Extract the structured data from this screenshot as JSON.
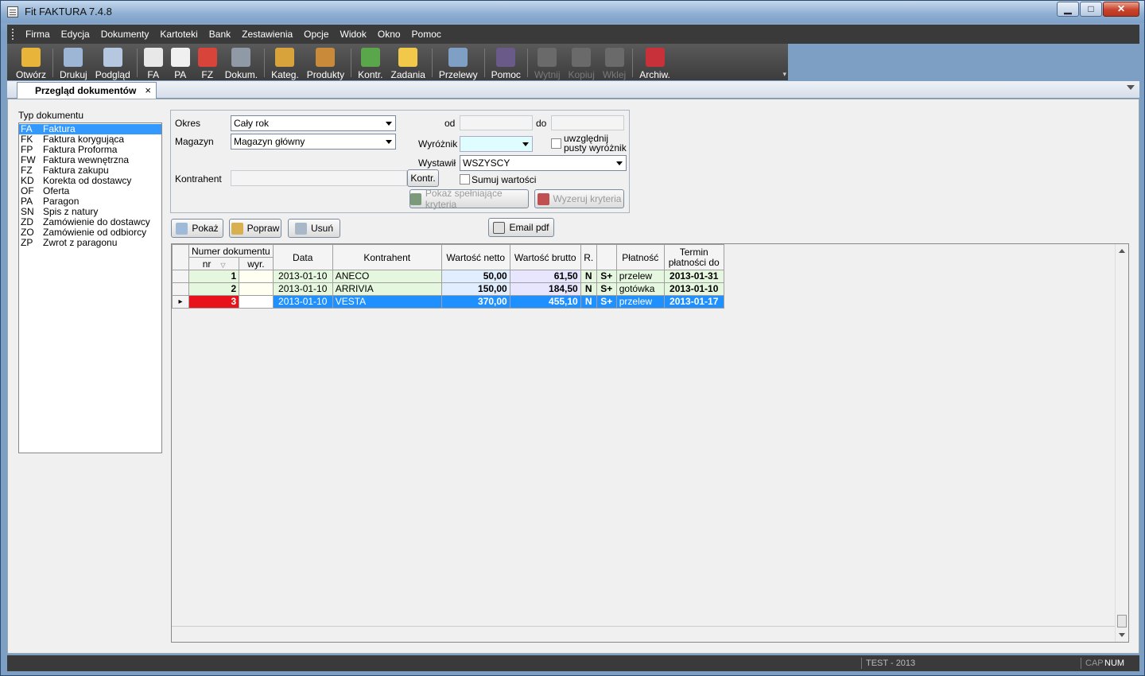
{
  "window": {
    "title": "Fit FAKTURA 7.4.8",
    "minimize": "▁",
    "maximize": "□",
    "close": "✕"
  },
  "menu": [
    "Firma",
    "Edycja",
    "Dokumenty",
    "Kartoteki",
    "Bank",
    "Zestawienia",
    "Opcje",
    "Widok",
    "Okno",
    "Pomoc"
  ],
  "toolbar": [
    {
      "label": "Otwórz",
      "icon": "folder-open-icon",
      "color": "#e8b53a",
      "enabled": true
    },
    {
      "sep": true
    },
    {
      "label": "Drukuj",
      "icon": "printer-icon",
      "color": "#9db6d6",
      "enabled": true
    },
    {
      "label": "Podgląd",
      "icon": "preview-icon",
      "color": "#b5c8e0",
      "enabled": true
    },
    {
      "sep": true
    },
    {
      "label": "FA",
      "icon": "invoice-icon",
      "color": "#e8e8e8",
      "enabled": true
    },
    {
      "label": "PA",
      "icon": "receipt-icon",
      "color": "#f0f0f0",
      "enabled": true
    },
    {
      "label": "FZ",
      "icon": "purchase-invoice-icon",
      "color": "#d8443a",
      "enabled": true
    },
    {
      "label": "Dokum.",
      "icon": "documents-icon",
      "color": "#8f9aa6",
      "enabled": true
    },
    {
      "sep": true
    },
    {
      "label": "Kateg.",
      "icon": "categories-icon",
      "color": "#d9a33b",
      "enabled": true
    },
    {
      "label": "Produkty",
      "icon": "products-icon",
      "color": "#c98a3a",
      "enabled": true
    },
    {
      "sep": true
    },
    {
      "label": "Kontr.",
      "icon": "contractors-icon",
      "color": "#5aa64a",
      "enabled": true
    },
    {
      "label": "Zadania",
      "icon": "tasks-icon",
      "color": "#f1c84a",
      "enabled": true
    },
    {
      "sep": true
    },
    {
      "label": "Przelewy",
      "icon": "transfers-icon",
      "color": "#7fa0c4",
      "enabled": true
    },
    {
      "sep": true
    },
    {
      "label": "Pomoc",
      "icon": "help-icon",
      "color": "#6a5a8a",
      "enabled": true
    },
    {
      "sep": true
    },
    {
      "label": "Wytnij",
      "icon": "cut-icon",
      "color": "#6a6a6a",
      "enabled": false
    },
    {
      "label": "Kopiuj",
      "icon": "copy-icon",
      "color": "#6a6a6a",
      "enabled": false
    },
    {
      "label": "Wklej",
      "icon": "paste-icon",
      "color": "#6a6a6a",
      "enabled": false
    },
    {
      "sep": true
    },
    {
      "label": "Archiw.",
      "icon": "archive-icon",
      "color": "#c8303a",
      "enabled": true
    }
  ],
  "tab": {
    "label": "Przegląd dokumentów",
    "close": "×"
  },
  "doc_types": {
    "label": "Typ dokumentu",
    "items": [
      {
        "code": "FA",
        "name": "Faktura",
        "selected": true
      },
      {
        "code": "FK",
        "name": "Faktura korygująca"
      },
      {
        "code": "FP",
        "name": "Faktura Proforma"
      },
      {
        "code": "FW",
        "name": "Faktura wewnętrzna"
      },
      {
        "code": "FZ",
        "name": "Faktura zakupu"
      },
      {
        "code": "KD",
        "name": "Korekta od dostawcy"
      },
      {
        "code": "OF",
        "name": "Oferta"
      },
      {
        "code": "PA",
        "name": "Paragon"
      },
      {
        "code": "SN",
        "name": "Spis z natury"
      },
      {
        "code": "ZD",
        "name": "Zamówienie do dostawcy"
      },
      {
        "code": "ZO",
        "name": "Zamówienie od odbiorcy"
      },
      {
        "code": "ZP",
        "name": "Zwrot z paragonu"
      }
    ]
  },
  "filters": {
    "okres_label": "Okres",
    "okres_value": "Cały rok",
    "magazyn_label": "Magazyn",
    "magazyn_value": "Magazyn główny",
    "kontrahent_label": "Kontrahent",
    "kontrahent_value": "",
    "kontr_button": "Kontr.",
    "od_label": "od",
    "od_value": "",
    "do_label": "do",
    "do_value": "",
    "wyroznik_label": "Wyróżnik",
    "wyroznik_value": "",
    "empty_marker_label": "uwzględnij pusty wyróżnik",
    "wystawil_label": "Wystawił",
    "wystawil_value": "WSZYSCY",
    "sum_label": "Sumuj wartości",
    "show_matching": "Pokaż spełniające kryteria",
    "reset_criteria": "Wyzeruj kryteria"
  },
  "actions": {
    "show": "Pokaż",
    "edit": "Popraw",
    "delete": "Usuń",
    "email_pdf": "Email pdf"
  },
  "grid": {
    "headers": {
      "numer": "Numer dokumentu",
      "nr": "nr",
      "wyr": "wyr.",
      "data": "Data",
      "kontrahent": "Kontrahent",
      "netto": "Wartość netto",
      "brutto": "Wartość brutto",
      "r": "R.",
      "platnosc": "Płatność",
      "termin_1": "Termin",
      "termin_2": "płatności do"
    },
    "rows": [
      {
        "nr": "1",
        "wyr": "",
        "data": "2013-01-10",
        "kontrahent": "ANECO",
        "netto": "50,00",
        "brutto": "61,50",
        "r": "N",
        "s": "S+",
        "platnosc": "przelew",
        "termin": "2013-01-31"
      },
      {
        "nr": "2",
        "wyr": "",
        "data": "2013-01-10",
        "kontrahent": "ARRIVIA",
        "netto": "150,00",
        "brutto": "184,50",
        "r": "N",
        "s": "S+",
        "platnosc": "gotówka",
        "termin": "2013-01-10"
      },
      {
        "nr": "3",
        "wyr": "",
        "data": "2013-01-10",
        "kontrahent": "VESTA",
        "netto": "370,00",
        "brutto": "455,10",
        "r": "N",
        "s": "S+",
        "platnosc": "przelew",
        "termin": "2013-01-17",
        "active": true
      }
    ]
  },
  "status": {
    "db": "TEST - 2013",
    "cap": "CAP",
    "num": "NUM"
  }
}
